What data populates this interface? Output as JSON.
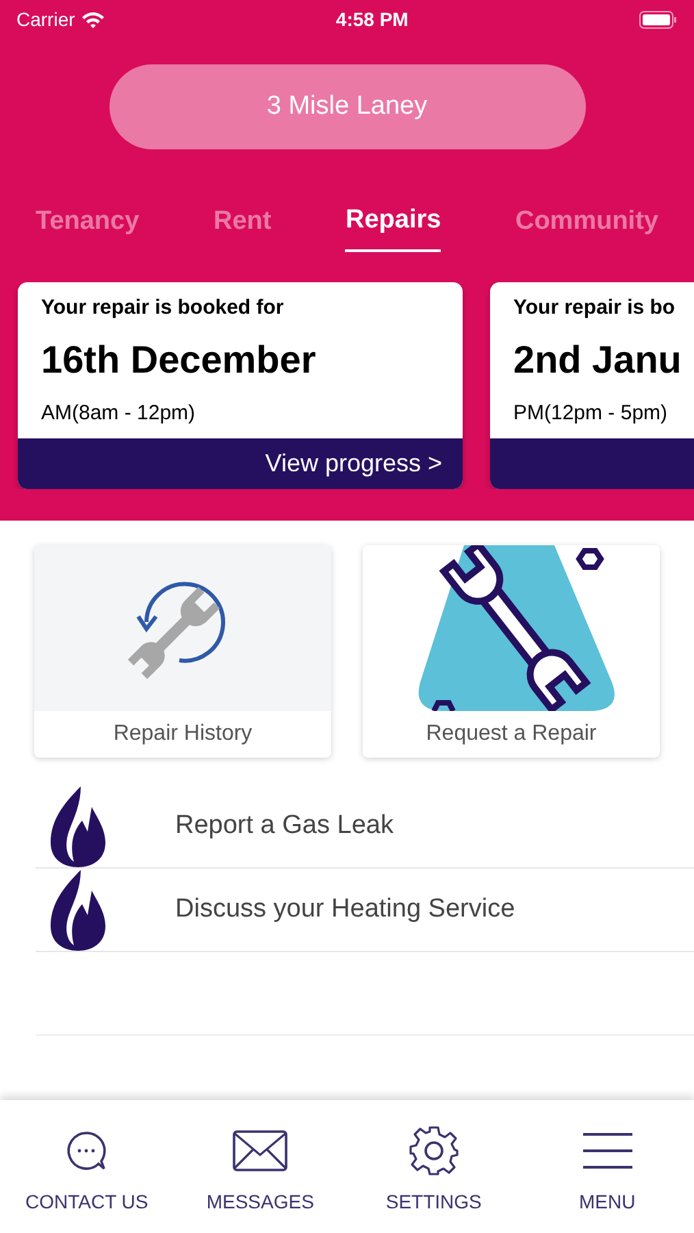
{
  "status_bar": {
    "carrier": "Carrier",
    "time": "4:58 PM"
  },
  "property": {
    "label": "3 Misle Laney"
  },
  "tabs": [
    {
      "label": "Tenancy",
      "selected": false
    },
    {
      "label": "Rent",
      "selected": false
    },
    {
      "label": "Repairs",
      "selected": true
    },
    {
      "label": "Community",
      "selected": false
    }
  ],
  "bookings": [
    {
      "heading": "Your repair is booked for",
      "date": "16th December",
      "slot": "AM(8am - 12pm)",
      "action": "View progress >"
    },
    {
      "heading": "Your repair is bo",
      "date": "2nd Janu",
      "slot": "PM(12pm - 5pm)"
    }
  ],
  "tiles": [
    {
      "label": "Repair History",
      "kind": "history"
    },
    {
      "label": "Request a Repair",
      "kind": "request"
    }
  ],
  "services": [
    {
      "label": "Report a Gas Leak"
    },
    {
      "label": "Discuss your Heating Service"
    }
  ],
  "bottom_nav": [
    {
      "label": "CONTACT US",
      "kind": "chat"
    },
    {
      "label": "MESSAGES",
      "kind": "mail"
    },
    {
      "label": "SETTINGS",
      "kind": "gear"
    },
    {
      "label": "MENU",
      "kind": "menu"
    }
  ]
}
